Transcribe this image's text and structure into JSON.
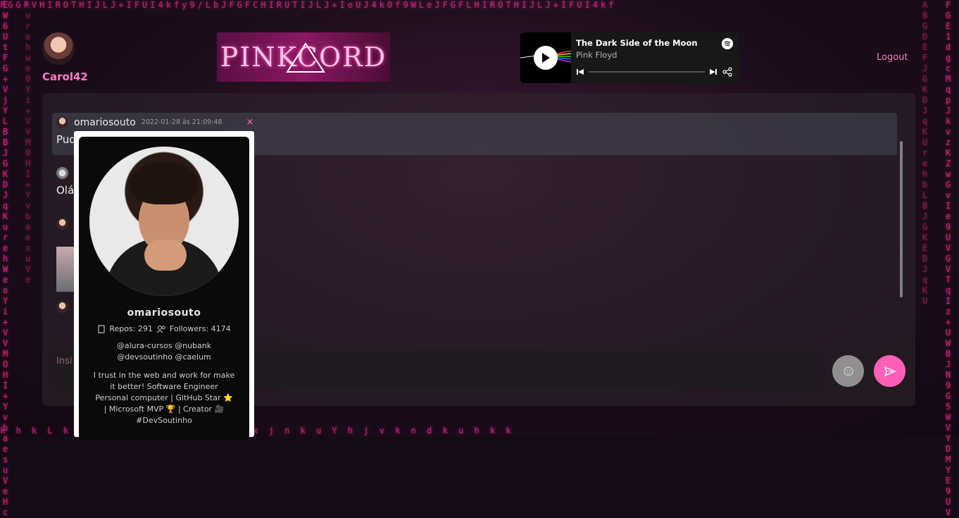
{
  "user": {
    "name": "Carol42"
  },
  "header": {
    "logo_text": "PINKCORD",
    "logout_label": "Logout"
  },
  "player": {
    "track_title": "The Dark Side of the Moon",
    "artist": "Pink Floyd"
  },
  "messages": [
    {
      "author": "omariosouto",
      "date": "2022-01-28 às 21:09:48",
      "text": "Pud",
      "close": "×"
    },
    {
      "author": "",
      "date": "",
      "text": "Olá",
      "close": ""
    }
  ],
  "composer": {
    "placeholder": "Insi"
  },
  "profile": {
    "username": "omariosouto",
    "repos_label": "Repos: 291",
    "followers_label": "Followers: 4174",
    "orgs": "@alura-cursos @nubank @devsoutinho @caelum",
    "bio": "I trust in the web and work for make it better!  Software Engineer Personal computer | GitHub Star ⭐ | Microsoft MVP 🏆 | Creator 🎥 #DevSoutinho"
  },
  "colors": {
    "accent": "#ff7ac6",
    "send": "#ff5fb6"
  }
}
